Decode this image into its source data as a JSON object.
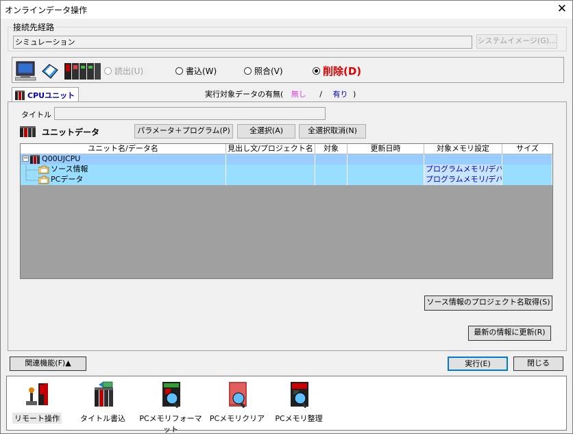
{
  "window": {
    "title": "オンラインデータ操作",
    "close": "✕"
  },
  "connection": {
    "legend": "接続先経路",
    "value": "シミュレーション",
    "system_image_button": "システムイメージ(G)..."
  },
  "operations": [
    {
      "label": "読出(U)",
      "state": "disabled"
    },
    {
      "label": "書込(W)",
      "state": "normal"
    },
    {
      "label": "照合(V)",
      "state": "normal"
    },
    {
      "label": "削除(D)",
      "state": "checked"
    }
  ],
  "tab": {
    "label": "CPUユニット"
  },
  "target_info": {
    "prefix": "実行対象データの有無(",
    "none": "無し",
    "sep": "/",
    "exists": "有り",
    "suffix": ")"
  },
  "title_field": {
    "label": "タイトル",
    "value": ""
  },
  "unit_data": {
    "label": "ユニットデータ",
    "param_program_button": "パラメータ＋プログラム(P)",
    "select_all_button": "全選択(A)",
    "deselect_all_button": "全選択取消(N)"
  },
  "table": {
    "columns": [
      "ユニット名/データ名",
      "見出し文/プロジェクト名",
      "対象",
      "更新日時",
      "対象メモリ設定",
      "サイズ"
    ],
    "rows": [
      {
        "name": "Q00UJCPU",
        "heading": "",
        "target": "",
        "updated": "",
        "memory": "",
        "size": "",
        "level": 0,
        "expander": "−"
      },
      {
        "name": "ソース情報",
        "heading": "",
        "target": "",
        "updated": "",
        "memory": "プログラムメモリ/デバ...",
        "size": "",
        "level": 1,
        "expander": ""
      },
      {
        "name": "PCデータ",
        "heading": "",
        "target": "",
        "updated": "",
        "memory": "プログラムメモリ/デバ...",
        "size": "",
        "level": 1,
        "expander": ""
      }
    ]
  },
  "source_project_button": "ソース情報のプロジェクト名取得(S)",
  "refresh_button": "最新の情報に更新(R)",
  "related_button": "関連機能(F)▲",
  "execute_button": "実行(E)",
  "close_button": "閉じる",
  "tools": [
    {
      "label": "リモート操作"
    },
    {
      "label": "タイトル書込"
    },
    {
      "label": "PCメモリフォーマット"
    },
    {
      "label": "PCメモリクリア"
    },
    {
      "label": "PCメモリ整理"
    }
  ],
  "colors": {
    "selected_row": "#99ccff",
    "child_row": "#99ddff",
    "link_blue": "#0000cc",
    "none_pink": "#e040e0",
    "delete_red": "#e00000"
  }
}
